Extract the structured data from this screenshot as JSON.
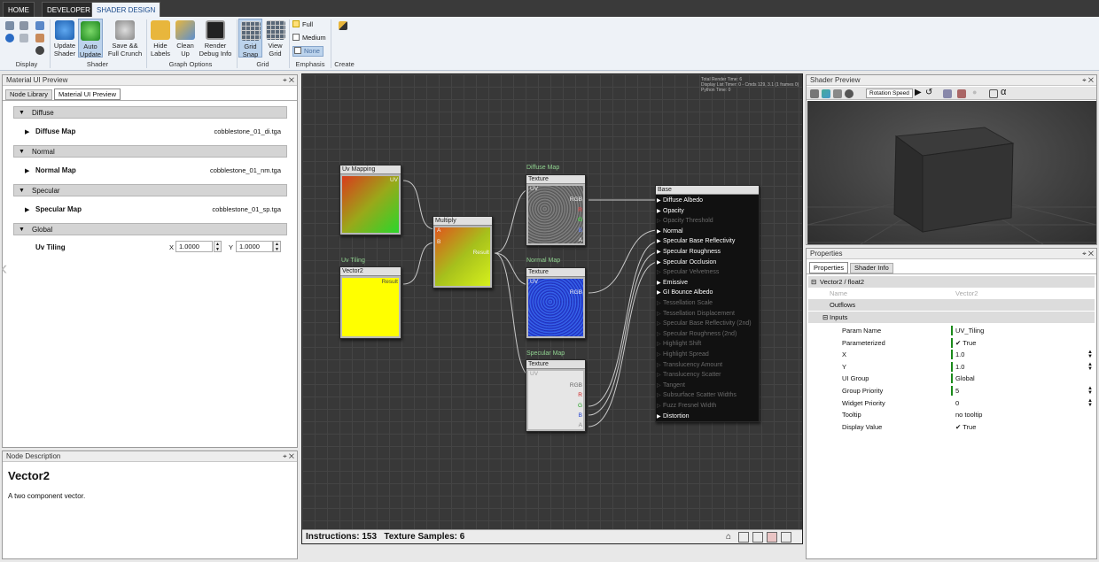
{
  "ribbon": {
    "tabs": [
      "HOME",
      "DEVELOPER",
      "SHADER DESIGN"
    ],
    "groups": {
      "display": "Display",
      "shader": "Shader",
      "graph_options": "Graph Options",
      "grid": "Grid",
      "emphasis": "Emphasis",
      "create": "Create"
    },
    "buttons": {
      "update_shader": "Update\nShader",
      "auto_update": "Auto\nUpdate",
      "save_full_crunch": "Save &&\nFull Crunch",
      "hide_labels": "Hide\nLabels",
      "clean_up": "Clean\nUp",
      "render_debug": "Render\nDebug Info",
      "grid_snap": "Grid\nSnap",
      "view_grid": "View\nGrid"
    },
    "emphasis": [
      "Full",
      "Medium",
      "None"
    ]
  },
  "material_panel": {
    "title": "Material UI Preview",
    "tabs": [
      "Node Library",
      "Material UI Preview"
    ],
    "sections": {
      "diffuse": "Diffuse",
      "normal": "Normal",
      "specular": "Specular",
      "global": "Global"
    },
    "rows": {
      "diffuse_label": "Diffuse Map",
      "diffuse_value": "cobblestone_01_di.tga",
      "normal_label": "Normal Map",
      "normal_value": "cobblestone_01_nm.tga",
      "specular_label": "Specular Map",
      "specular_value": "cobblestone_01_sp.tga",
      "tiling_label": "Uv Tiling",
      "x_label": "X",
      "x_value": "1.0000",
      "y_label": "Y",
      "y_value": "1.0000"
    }
  },
  "node_desc": {
    "title": "Node Description",
    "heading": "Vector2",
    "text": "A two component vector."
  },
  "graph": {
    "stats": {
      "line1": "Total Render Time: 6",
      "line2": "Display List Timer: 0 - Cmds 129, 3.1 (1 frames 0)",
      "line3": "Python Time: 0"
    },
    "status": "Instructions: 153   Texture Samples: 6",
    "nodes": {
      "uvmap_title": "Uv Mapping",
      "uvmap_port": "UV",
      "uvtiling_caption": "Uv Tiling",
      "vector2_title": "Vector2",
      "vector2_port": "Result",
      "multiply_title": "Multiply",
      "multiply_a": "A",
      "multiply_b": "B",
      "multiply_result": "Result",
      "diffuse_caption": "Diffuse Map",
      "normal_caption": "Normal Map",
      "specular_caption": "Specular Map",
      "texture_title": "Texture",
      "uv": "UV",
      "rgb": "RGB",
      "r": "R",
      "g": "G",
      "b": "B",
      "a": "A",
      "base_title": "Base"
    },
    "base_inputs": [
      {
        "label": "Diffuse Albedo",
        "on": true
      },
      {
        "label": "Opacity",
        "on": true
      },
      {
        "label": "Opacity Threshold",
        "on": false
      },
      {
        "label": "Normal",
        "on": true
      },
      {
        "label": "Specular Base Reflectivity",
        "on": true
      },
      {
        "label": "Specular Roughness",
        "on": true
      },
      {
        "label": "Specular Occlusion",
        "on": true
      },
      {
        "label": "Specular Velvetness",
        "on": false
      },
      {
        "label": "Emissive",
        "on": true
      },
      {
        "label": "GI Bounce Albedo",
        "on": true
      },
      {
        "label": "Tessellation Scale",
        "on": false
      },
      {
        "label": "Tessellation Displacement",
        "on": false
      },
      {
        "label": "Specular Base Reflectivity (2nd)",
        "on": false
      },
      {
        "label": "Specular Roughness (2nd)",
        "on": false
      },
      {
        "label": "Highlight Shift",
        "on": false
      },
      {
        "label": "Highlight Spread",
        "on": false
      },
      {
        "label": "Translucency Amount",
        "on": false
      },
      {
        "label": "Translucency Scatter",
        "on": false
      },
      {
        "label": "Tangent",
        "on": false
      },
      {
        "label": "Subsurface Scatter Widths",
        "on": false
      },
      {
        "label": "Fuzz Fresnel Width",
        "on": false
      },
      {
        "label": "Distortion",
        "on": true
      }
    ]
  },
  "preview": {
    "title": "Shader Preview",
    "rotation_speed": "Rotation Speed"
  },
  "properties": {
    "title": "Properties",
    "tabs": [
      "Properties",
      "Shader Info"
    ],
    "node": "Vector2 / float2",
    "name_label": "Name",
    "name_value": "Vector2",
    "outflows": "Outflows",
    "inputs": "Inputs",
    "rows": [
      {
        "k": "Param Name",
        "v": "UV_Tiling"
      },
      {
        "k": "Parameterized",
        "v": "True"
      },
      {
        "k": "X",
        "v": "1.0"
      },
      {
        "k": "Y",
        "v": "1.0"
      },
      {
        "k": "UI Group",
        "v": "Global"
      },
      {
        "k": "Group Priority",
        "v": "5"
      },
      {
        "k": "Widget Priority",
        "v": "0"
      },
      {
        "k": "Tooltip",
        "v": "no tooltip"
      },
      {
        "k": "Display Value",
        "v": "True"
      }
    ]
  },
  "colors": {
    "accent": "#1a4a8a",
    "graph_bg": "#383838",
    "green": "#1a8a1a"
  }
}
